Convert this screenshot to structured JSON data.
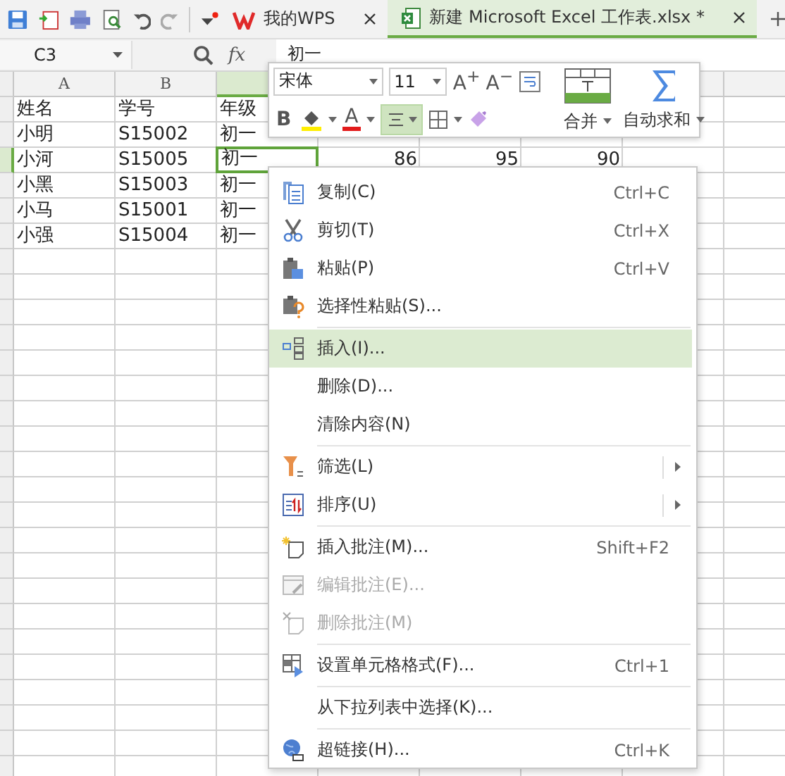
{
  "tabs": [
    {
      "label": "我的WPS",
      "selected": false,
      "kind": "home"
    },
    {
      "label": "新建 Microsoft Excel 工作表.xlsx *",
      "selected": true,
      "kind": "doc"
    }
  ],
  "name_box": "C3",
  "fx_label": "fx",
  "formula": "初一",
  "columns": [
    {
      "label": "A",
      "selected": false
    },
    {
      "label": "B",
      "selected": false
    },
    {
      "selected": true
    }
  ],
  "rows": [
    {
      "selected": false,
      "cells": [
        "姓名",
        "学号",
        "年级"
      ]
    },
    {
      "selected": false,
      "cells": [
        "小明",
        "S15002",
        "初一"
      ]
    },
    {
      "selected": true,
      "cells": [
        "小河",
        "S15005",
        "初一",
        "86",
        "95",
        "90"
      ]
    },
    {
      "selected": false,
      "cells": [
        "小黑",
        "S15003",
        "初一"
      ]
    },
    {
      "selected": false,
      "cells": [
        "小马",
        "S15001",
        "初一"
      ]
    },
    {
      "selected": false,
      "cells": [
        "小强",
        "S15004",
        "初一"
      ]
    }
  ],
  "mini_toolbar": {
    "font": "宋体",
    "size": "11",
    "grow_label": "A$^{+}$",
    "shrink_label": "A$^{−}$",
    "bold_label": "B",
    "font_color_label": "A",
    "align_center_selected": true,
    "merge_label": "合并",
    "autosum_label": "自动求和"
  },
  "context_menu": [
    {
      "kind": "item",
      "label": "复制(C)",
      "shortcut": "Ctrl+C",
      "disabled": false,
      "selected": false,
      "submenu": false
    },
    {
      "kind": "item",
      "label": "剪切(T)",
      "shortcut": "Ctrl+X",
      "disabled": false,
      "selected": false,
      "submenu": false
    },
    {
      "kind": "item",
      "label": "粘贴(P)",
      "shortcut": "Ctrl+V",
      "disabled": false,
      "selected": false,
      "submenu": false
    },
    {
      "kind": "item",
      "label": "选择性粘贴(S)...",
      "disabled": false,
      "selected": false,
      "submenu": false
    },
    {
      "kind": "separator"
    },
    {
      "kind": "item",
      "label": "插入(I)...",
      "disabled": false,
      "selected": true,
      "submenu": false
    },
    {
      "kind": "item",
      "label": "删除(D)...",
      "disabled": false,
      "selected": false,
      "submenu": false
    },
    {
      "kind": "item",
      "label": "清除内容(N)",
      "disabled": false,
      "selected": false,
      "submenu": false
    },
    {
      "kind": "separator"
    },
    {
      "kind": "item",
      "label": "筛选(L)",
      "disabled": false,
      "selected": false,
      "submenu": true
    },
    {
      "kind": "item",
      "label": "排序(U)",
      "disabled": false,
      "selected": false,
      "submenu": true
    },
    {
      "kind": "separator"
    },
    {
      "kind": "item",
      "label": "插入批注(M)...",
      "shortcut": "Shift+F2",
      "disabled": false,
      "selected": false,
      "submenu": false
    },
    {
      "kind": "item",
      "label": "编辑批注(E)...",
      "disabled": true,
      "selected": false,
      "submenu": false
    },
    {
      "kind": "item",
      "label": "删除批注(M)",
      "disabled": true,
      "selected": false,
      "submenu": false
    },
    {
      "kind": "separator"
    },
    {
      "kind": "item",
      "label": "设置单元格格式(F)...",
      "shortcut": "Ctrl+1",
      "disabled": false,
      "selected": false,
      "submenu": false
    },
    {
      "kind": "separator"
    },
    {
      "kind": "item",
      "label": "从下拉列表中选择(K)...",
      "disabled": false,
      "selected": false,
      "submenu": false
    },
    {
      "kind": "separator"
    },
    {
      "kind": "item",
      "label": "超链接(H)...",
      "shortcut": "Ctrl+K",
      "disabled": false,
      "selected": false,
      "submenu": false
    }
  ]
}
